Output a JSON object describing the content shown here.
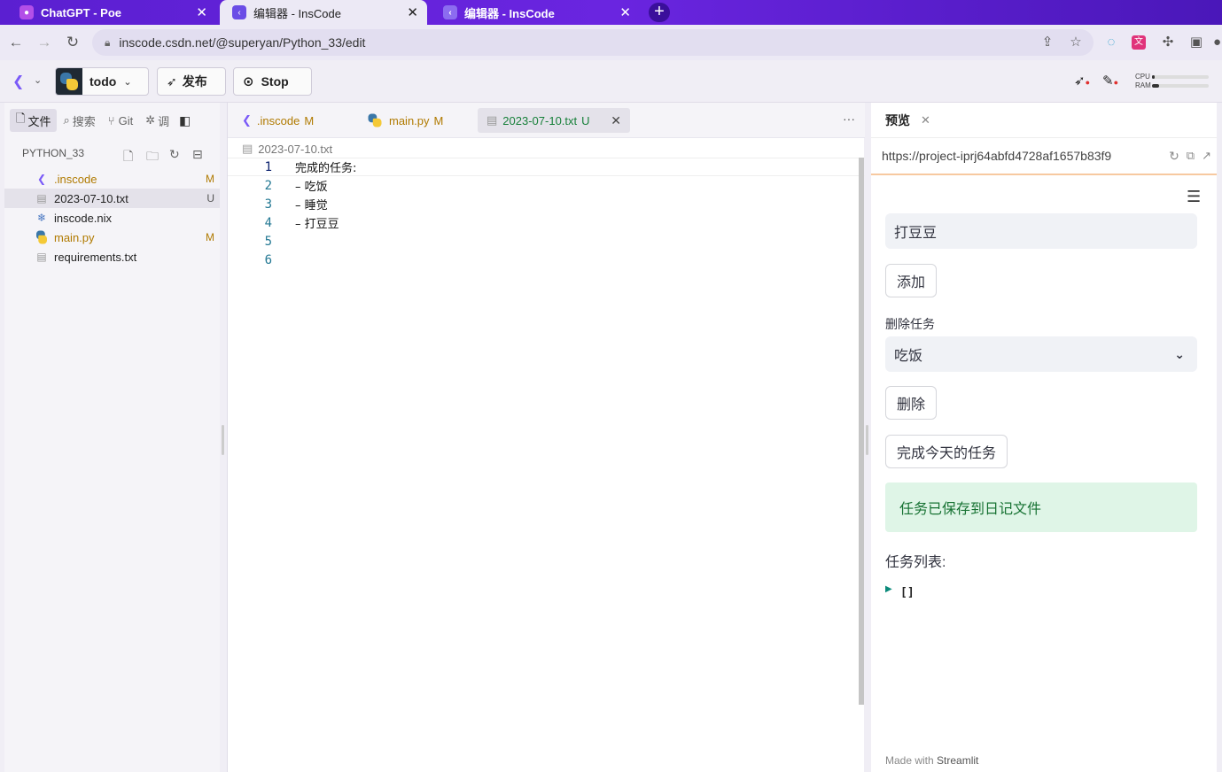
{
  "browser": {
    "tabs": [
      {
        "title": "ChatGPT - Poe",
        "close": "✕"
      },
      {
        "title": "编辑器 - InsCode",
        "close": "✕"
      },
      {
        "title": "编辑器 - InsCode",
        "close": "✕"
      }
    ],
    "new_tab": "+",
    "url": "inscode.csdn.net/@superyan/Python_33/edit"
  },
  "toolbar": {
    "project": "todo",
    "publish": "发布",
    "stop": "Stop",
    "cpu_label": "CPU",
    "ram_label": "RAM",
    "cpu_usage": 0.05,
    "ram_usage": 0.12
  },
  "sidebar": {
    "tabs": [
      "文件",
      "搜索",
      "Git",
      "调"
    ],
    "project_title": "PYTHON_33",
    "files": [
      {
        "name": ".inscode",
        "status": "M",
        "icon": "inscode-icon"
      },
      {
        "name": "2023-07-10.txt",
        "status": "U",
        "icon": "text-file-icon"
      },
      {
        "name": "inscode.nix",
        "status": "",
        "icon": "nix-icon"
      },
      {
        "name": "main.py",
        "status": "M",
        "icon": "python-icon"
      },
      {
        "name": "requirements.txt",
        "status": "",
        "icon": "text-file-icon"
      }
    ]
  },
  "editor": {
    "tabs": [
      {
        "name": ".inscode",
        "status": "M"
      },
      {
        "name": "main.py",
        "status": "M"
      },
      {
        "name": "2023-07-10.txt",
        "status": "U"
      }
    ],
    "more": "···",
    "breadcrumb": "2023-07-10.txt",
    "lines": [
      {
        "num": "1",
        "text": "完成的任务:"
      },
      {
        "num": "2",
        "text": "– 吃饭"
      },
      {
        "num": "3",
        "text": "– 睡觉"
      },
      {
        "num": "4",
        "text": "– 打豆豆"
      },
      {
        "num": "5",
        "text": ""
      },
      {
        "num": "6",
        "text": ""
      }
    ]
  },
  "preview": {
    "title": "预览",
    "url": "https://project-iprj64abfd4728af1657b83f9",
    "task_input": "打豆豆",
    "add_button": "添加",
    "delete_label": "删除任务",
    "delete_select": "吃饭",
    "delete_button": "删除",
    "complete_button": "完成今天的任务",
    "success_message": "任务已保存到日记文件",
    "list_label": "任务列表:",
    "list_value": "[]",
    "footer_prefix": "Made with",
    "footer_brand": "Streamlit"
  },
  "colors": {
    "tabstrip": "#5b1fd1",
    "modified": "#b07a00",
    "active_tab": "#17803a",
    "success_bg": "#dff5e7",
    "success_text": "#177233"
  }
}
